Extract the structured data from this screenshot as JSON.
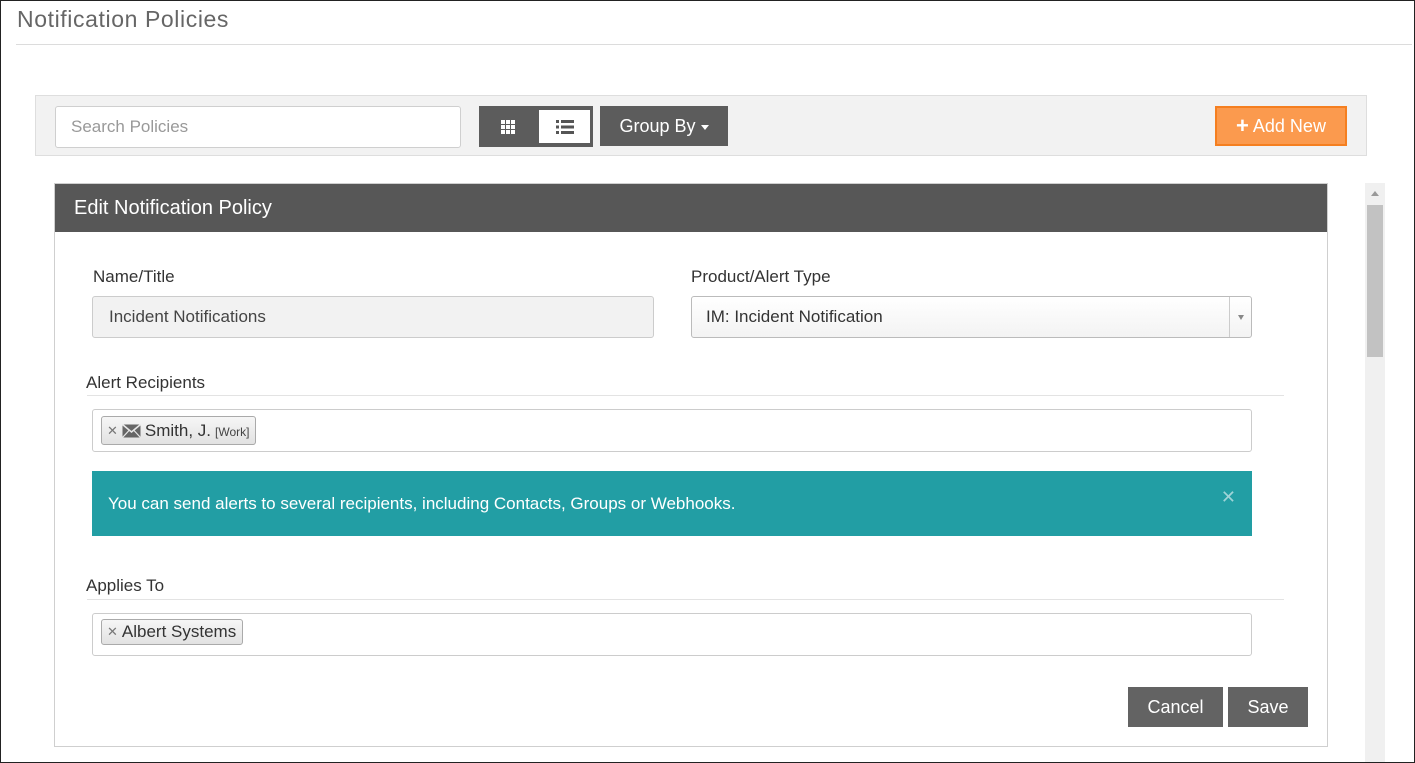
{
  "page": {
    "title": "Notification Policies"
  },
  "toolbar": {
    "search_placeholder": "Search Policies",
    "group_by_label": "Group By",
    "add_new_label": "Add New",
    "add_new_color": "#fb9a4e"
  },
  "panel": {
    "header": "Edit Notification Policy",
    "name_label": "Name/Title",
    "name_value": "Incident Notifications",
    "type_label": "Product/Alert Type",
    "type_value": "IM: Incident Notification",
    "recipients_label": "Alert Recipients",
    "recipients": [
      {
        "name": "Smith, J.",
        "qualifier": "[Work]",
        "icon": "envelope-icon"
      }
    ],
    "info_message": "You can send alerts to several recipients, including Contacts, Groups or Webhooks.",
    "info_color": "#229ea4",
    "applies_to_label": "Applies To",
    "applies_to": [
      {
        "name": "Albert Systems"
      }
    ],
    "cancel_label": "Cancel",
    "save_label": "Save"
  }
}
